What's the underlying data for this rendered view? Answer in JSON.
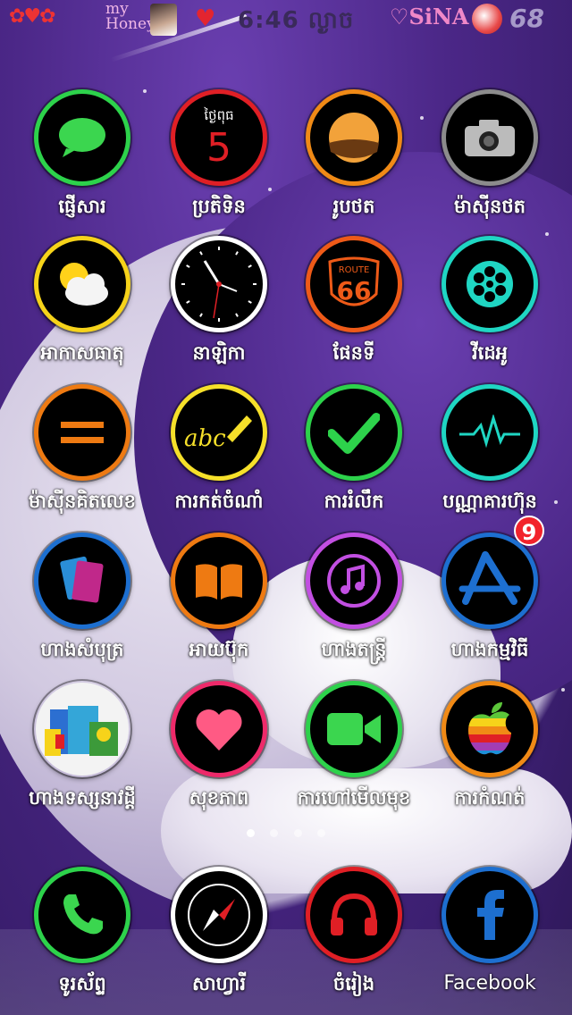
{
  "status_bar": {
    "my_text": "my",
    "honey_text": "Honey",
    "time": "6:46 ល្ងាច",
    "carrier": "SiNA",
    "battery": "68"
  },
  "apps": [
    {
      "label": "ផ្ញើសារ",
      "icon": "message-icon",
      "ring_color": "#2dd24b"
    },
    {
      "label": "ប្រតិទិន",
      "icon": "calendar-icon",
      "ring_color": "#e01f25",
      "calendar_day": "ថ្ងៃពុធ",
      "calendar_date": "5"
    },
    {
      "label": "រូបថត",
      "icon": "photos-icon",
      "ring_color": "#f08a16"
    },
    {
      "label": "ម៉ាស៊ីនថត",
      "icon": "camera-icon",
      "ring_color": "#8c8c8c"
    },
    {
      "label": "អាកាសធាតុ",
      "icon": "weather-icon",
      "ring_color": "#f6d31a"
    },
    {
      "label": "នាឡិកា",
      "icon": "clock-icon",
      "ring_color": "#ffffff"
    },
    {
      "label": "ផែនទី",
      "icon": "maps-icon",
      "ring_color": "#ee5a18",
      "route_text": "ROUTE",
      "route_number": "66"
    },
    {
      "label": "វីដេអូ",
      "icon": "video-reel-icon",
      "ring_color": "#1fd6c3"
    },
    {
      "label": "ម៉ាស៊ីនគិតលេខ",
      "icon": "calculator-icon",
      "ring_color": "#ee7a12"
    },
    {
      "label": "ការកត់ចំណាំ",
      "icon": "notes-icon",
      "ring_color": "#f6e02a",
      "notes_text": "abc"
    },
    {
      "label": "ការរំលឹក",
      "icon": "reminders-icon",
      "ring_color": "#2dd24b"
    },
    {
      "label": "បណ្ណាគារហ៊ុន",
      "icon": "stocks-icon",
      "ring_color": "#1fd6c3"
    },
    {
      "label": "ហាងសំបុត្រ",
      "icon": "wallet-icon",
      "ring_color": "#1d6fd0"
    },
    {
      "label": "អាយប៊ុក",
      "icon": "ibooks-icon",
      "ring_color": "#ee7a12"
    },
    {
      "label": "ហាងតន្ត្រី",
      "icon": "music-icon",
      "ring_color": "#c24fe2"
    },
    {
      "label": "ហាងកម្មវិធី",
      "icon": "app-store-icon",
      "ring_color": "#1d6fd0",
      "badge": "9"
    },
    {
      "label": "ហាងទស្សនាវដ្តី",
      "icon": "newsstand-icon",
      "ring_color": "#ffffff"
    },
    {
      "label": "សុខភាព",
      "icon": "health-icon",
      "ring_color": "#ee2a6a"
    },
    {
      "label": "ការហៅមើលមុខ",
      "icon": "facetime-icon",
      "ring_color": "#2dd24b"
    },
    {
      "label": "ការកំណត់",
      "icon": "apple-icon",
      "ring_color": "#f08a16"
    }
  ],
  "dock": [
    {
      "label": "ទូរស័ព្ទ",
      "icon": "phone-icon",
      "ring_color": "#2dd24b"
    },
    {
      "label": "សាហ្វារី",
      "icon": "compass-icon",
      "ring_color": "#ffffff"
    },
    {
      "label": "ចំរៀង",
      "icon": "headphones-icon",
      "ring_color": "#e01f25"
    },
    {
      "label": "Facebook",
      "icon": "facebook-icon",
      "ring_color": "#1d6fd0"
    }
  ],
  "page_indicator": {
    "pages": 4,
    "active": 0
  }
}
